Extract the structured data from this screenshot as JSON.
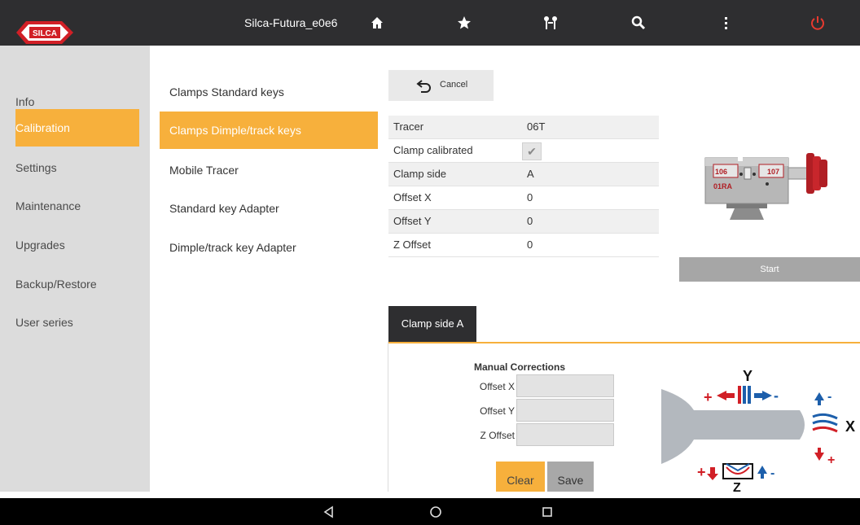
{
  "app": {
    "title": "Silca-Futura_e0e6",
    "logo_text": "SILCA",
    "accent_color": "#f7b03c",
    "topbar_color": "#2e2e30",
    "topbar_icons": [
      "home-icon",
      "star-icon",
      "keys-icon",
      "search-icon",
      "more-vert-icon",
      "power-icon"
    ]
  },
  "sidebar": {
    "items": [
      {
        "label": "Info"
      },
      {
        "label": "Calibration",
        "active": true
      },
      {
        "label": "Settings"
      },
      {
        "label": "Maintenance"
      },
      {
        "label": "Upgrades"
      },
      {
        "label": "Backup/Restore"
      },
      {
        "label": "User series"
      }
    ]
  },
  "submenu": {
    "items": [
      {
        "label": "Clamps Standard keys"
      },
      {
        "label": "Clamps Dimple/track keys",
        "active": true
      },
      {
        "label": "Mobile Tracer"
      },
      {
        "label": "Standard key Adapter"
      },
      {
        "label": "Dimple/track key Adapter"
      }
    ]
  },
  "toolbar": {
    "cancel_label": "Cancel"
  },
  "properties": [
    {
      "key": "Tracer",
      "value": "06T"
    },
    {
      "key": "Clamp calibrated",
      "value": "",
      "checked": true
    },
    {
      "key": "Clamp side",
      "value": "A"
    },
    {
      "key": "Offset X",
      "value": "0"
    },
    {
      "key": "Offset Y",
      "value": "0"
    },
    {
      "key": "Z Offset",
      "value": "0"
    }
  ],
  "clamp_image": {
    "left_label": "106",
    "right_label": "107",
    "bottom_label": "01RA"
  },
  "start_label": "Start",
  "tab": {
    "label": "Clamp side A"
  },
  "manual_corrections": {
    "title": "Manual Corrections",
    "fields": [
      {
        "label": "Offset X",
        "value": ""
      },
      {
        "label": "Offset Y",
        "value": ""
      },
      {
        "label": "Z Offset",
        "value": ""
      }
    ],
    "clear_label": "Clear",
    "save_label": "Save"
  },
  "diagram": {
    "y_label": "Y",
    "x_label": "X",
    "z_label": "Z"
  }
}
